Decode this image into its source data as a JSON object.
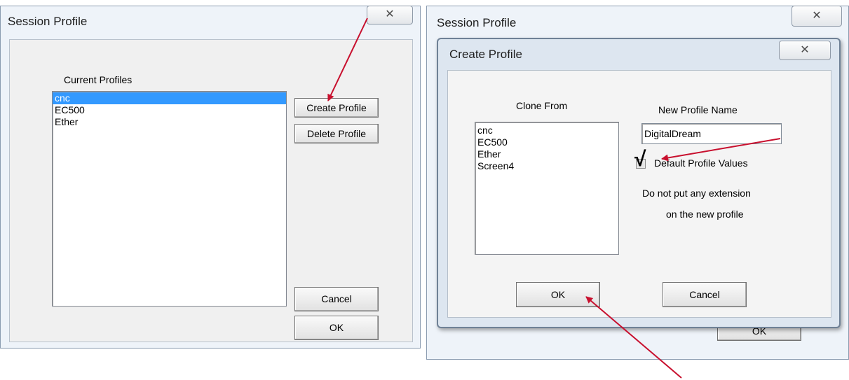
{
  "left_window": {
    "title": "Session Profile",
    "close_glyph": "✕",
    "profiles_label": "Current Profiles",
    "profiles": [
      "cnc",
      "EC500",
      "Ether"
    ],
    "selected_index": 0,
    "buttons": {
      "create": "Create Profile",
      "delete": "Delete Profile",
      "cancel": "Cancel",
      "ok": "OK"
    }
  },
  "right_window": {
    "title": "Session Profile",
    "close_glyph": "✕",
    "behind_ok": "OK"
  },
  "create_dialog": {
    "title": "Create Profile",
    "close_glyph": "✕",
    "clone_from_label": "Clone From",
    "clone_from_items": [
      "cnc",
      "EC500",
      "Ether",
      "Screen4"
    ],
    "new_name_label": "New Profile Name",
    "new_name_value": "DigitalDream",
    "default_values_label": "Default Profile Values",
    "default_values_checked": true,
    "note_line1": "Do not put any extension",
    "note_line2": "on the new profile",
    "buttons": {
      "ok": "OK",
      "cancel": "Cancel"
    }
  },
  "annotation": {
    "arrow_color": "#c8102e",
    "check_mark": "√"
  }
}
